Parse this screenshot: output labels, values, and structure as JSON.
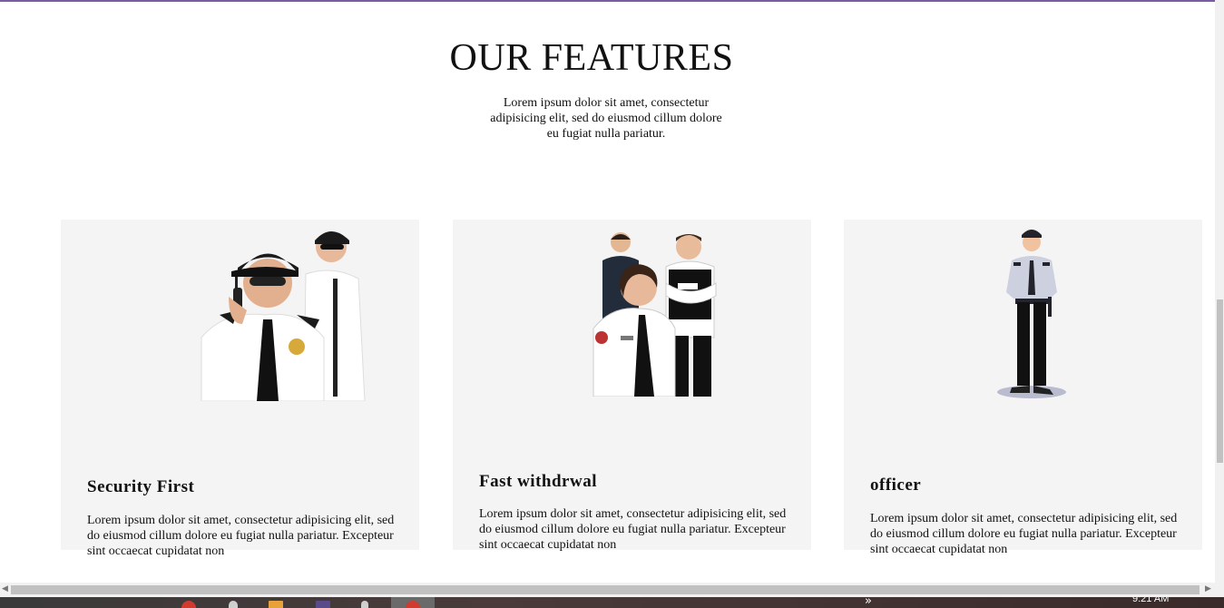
{
  "section": {
    "title": "OUR FEATURES",
    "intro": "Lorem ipsum dolor sit amet, consectetur adipisicing elit, sed do eiusmod cillum dolore eu fugiat nulla pariatur."
  },
  "cards": [
    {
      "heading": "Security First",
      "text": "Lorem ipsum dolor sit amet, consectetur adipisicing elit, sed do eiusmod cillum dolore eu fugiat nulla pariatur. Excepteur sint occaecat cupidatat non"
    },
    {
      "heading": "Fast withdrwal",
      "text": "Lorem ipsum dolor sit amet, consectetur adipisicing elit, sed do eiusmod cillum dolore eu fugiat nulla pariatur. Excepteur sint occaecat cupidatat non"
    },
    {
      "heading": "officer",
      "text": "Lorem ipsum dolor sit amet, consectetur adipisicing elit, sed do eiusmod cillum dolore eu fugiat nulla pariatur. Excepteur sint occaecat cupidatat non"
    }
  ],
  "taskbar": {
    "overflow_chevron": "»",
    "clock": "9:21 AM"
  },
  "colors": {
    "top_border": "#7b5aa6",
    "card_bg": "#f4f4f4"
  }
}
